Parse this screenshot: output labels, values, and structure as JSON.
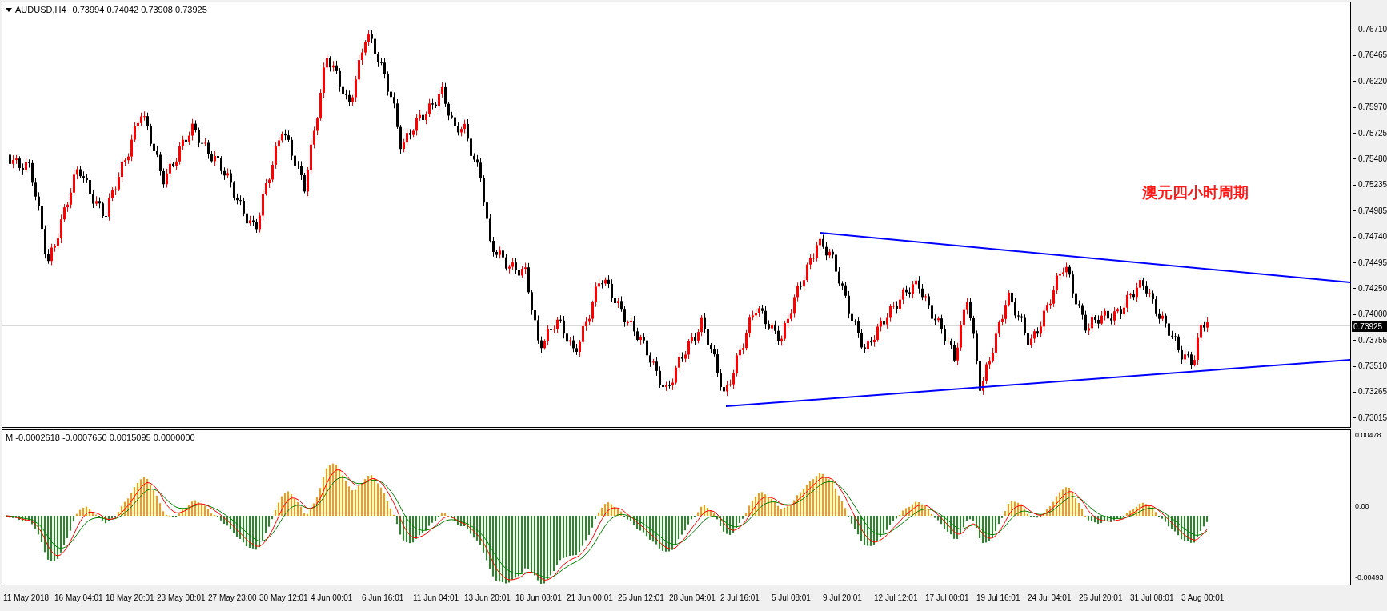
{
  "chart": {
    "title": "AUDUSD,H4",
    "ohlc": "0.73994 0.74042 0.73908 0.73925",
    "annotation": "澳元四小时周期",
    "current_price": "0.73925",
    "price_labels": [
      "0.76710",
      "0.76465",
      "0.76220",
      "0.75970",
      "0.75725",
      "0.75480",
      "0.75235",
      "0.74985",
      "0.74740",
      "0.74495",
      "0.74250",
      "0.74000",
      "0.73755",
      "0.73510",
      "0.73265",
      "0.73015"
    ]
  },
  "indicator": {
    "title": "M -0.0002618 -0.0007650 0.0015095 0.0000000",
    "labels": [
      "0.00478",
      "0.00",
      "-0.00493"
    ]
  },
  "time_axis": [
    "11 May 2018",
    "16 May 04:01",
    "18 May 20:01",
    "23 May 08:01",
    "27 May 23:00",
    "30 May 12:01",
    "4 Jun 00:01",
    "6 Jun 16:01",
    "11 Jun 04:01",
    "13 Jun 20:01",
    "18 Jun 08:01",
    "21 Jun 00:01",
    "25 Jun 12:01",
    "28 Jun 04:01",
    "2 Jul 16:01",
    "5 Jul 08:01",
    "9 Jul 20:01",
    "12 Jul 12:01",
    "17 Jul 00:01",
    "19 Jul 16:01",
    "24 Jul 04:01",
    "26 Jul 20:01",
    "31 Jul 08:01",
    "3 Aug 00:01"
  ]
}
